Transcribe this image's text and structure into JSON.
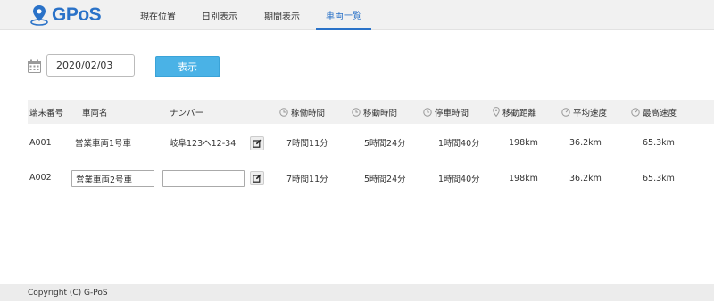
{
  "app": {
    "logo_text": "GPoS"
  },
  "nav": [
    {
      "label": "現在位置",
      "active": false
    },
    {
      "label": "日別表示",
      "active": false
    },
    {
      "label": "期間表示",
      "active": false
    },
    {
      "label": "車両一覧",
      "active": true
    }
  ],
  "date_filter": {
    "value": "2020/02/03",
    "button_label": "表示",
    "icon": "calendar-icon"
  },
  "table": {
    "headers": {
      "terminal": "端末番号",
      "vehicle_name": "車両名",
      "number": "ナンバー",
      "operating_time": "稼働時間",
      "moving_time": "移動時間",
      "stop_time": "停車時間",
      "distance": "移動距離",
      "avg_speed": "平均速度",
      "max_speed": "最高速度"
    },
    "rows": [
      {
        "terminal": "A001",
        "vehicle_name": "営業車両1号車",
        "number": "岐阜123へ12-34",
        "operating_time": "7時間11分",
        "moving_time": "5時間24分",
        "stop_time": "1時間40分",
        "distance": "198km",
        "avg_speed": "36.2km",
        "max_speed": "65.3km"
      },
      {
        "terminal": "A002",
        "vehicle_name": "営業車両2号車",
        "number": "",
        "operating_time": "7時間11分",
        "moving_time": "5時間24分",
        "stop_time": "1時間40分",
        "distance": "198km",
        "avg_speed": "36.2km",
        "max_speed": "65.3km"
      }
    ]
  },
  "footer": {
    "copyright": "Copyright (C) G-PoS"
  },
  "colors": {
    "brand": "#2a72c8",
    "button": "#4ab2e6",
    "header_bg": "#f1f1f1"
  }
}
